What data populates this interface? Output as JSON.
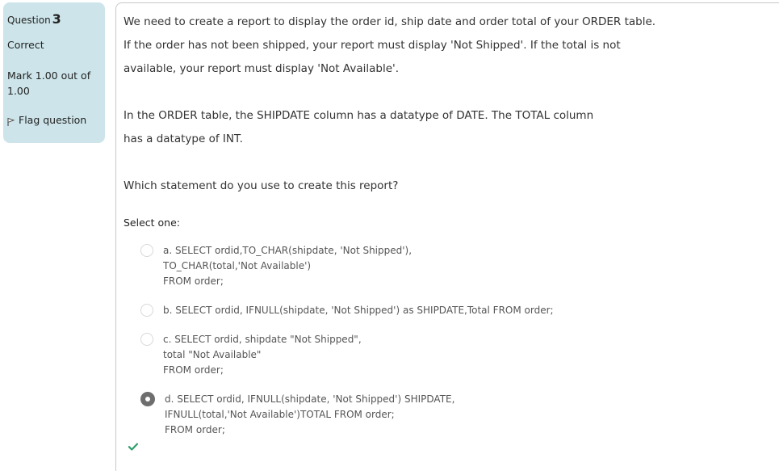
{
  "info": {
    "question_label": "Question",
    "question_number": "3",
    "state": "Correct",
    "grade": "Mark 1.00 out of 1.00",
    "flag_label": "Flag question"
  },
  "question": {
    "paragraphs": [
      "We need to create a report to display the order id, ship date and order total of your ORDER table. If the order has not been shipped, your report must display 'Not Shipped'. If the total is not available, your report must display 'Not Available'.",
      "In the ORDER table, the SHIPDATE column has a datatype of DATE. The TOTAL column has a datatype of INT.",
      "Which statement do you use to create this report?"
    ],
    "select_prompt": "Select one:"
  },
  "answers": [
    {
      "lines": [
        "a. SELECT ordid,TO_CHAR(shipdate, 'Not Shipped'),",
        "TO_CHAR(total,'Not Available')",
        "FROM order;"
      ],
      "selected": false
    },
    {
      "lines": [
        "b. SELECT ordid, IFNULL(shipdate, 'Not Shipped') as SHIPDATE,Total FROM order;"
      ],
      "selected": false
    },
    {
      "lines": [
        "c. SELECT ordid, shipdate \"Not Shipped\",",
        "total \"Not Available\"",
        "FROM order;"
      ],
      "selected": false
    },
    {
      "lines": [
        "d. SELECT ordid, IFNULL(shipdate, 'Not Shipped') SHIPDATE,",
        "IFNULL(total,'Not Available')TOTAL FROM order;",
        "FROM order;"
      ],
      "selected": true
    }
  ],
  "result_icon": "checkmark-icon",
  "colors": {
    "info_background": "#cde5ea",
    "correct_check": "#2e9e6b",
    "selected_radio": "#6e6e6e"
  }
}
